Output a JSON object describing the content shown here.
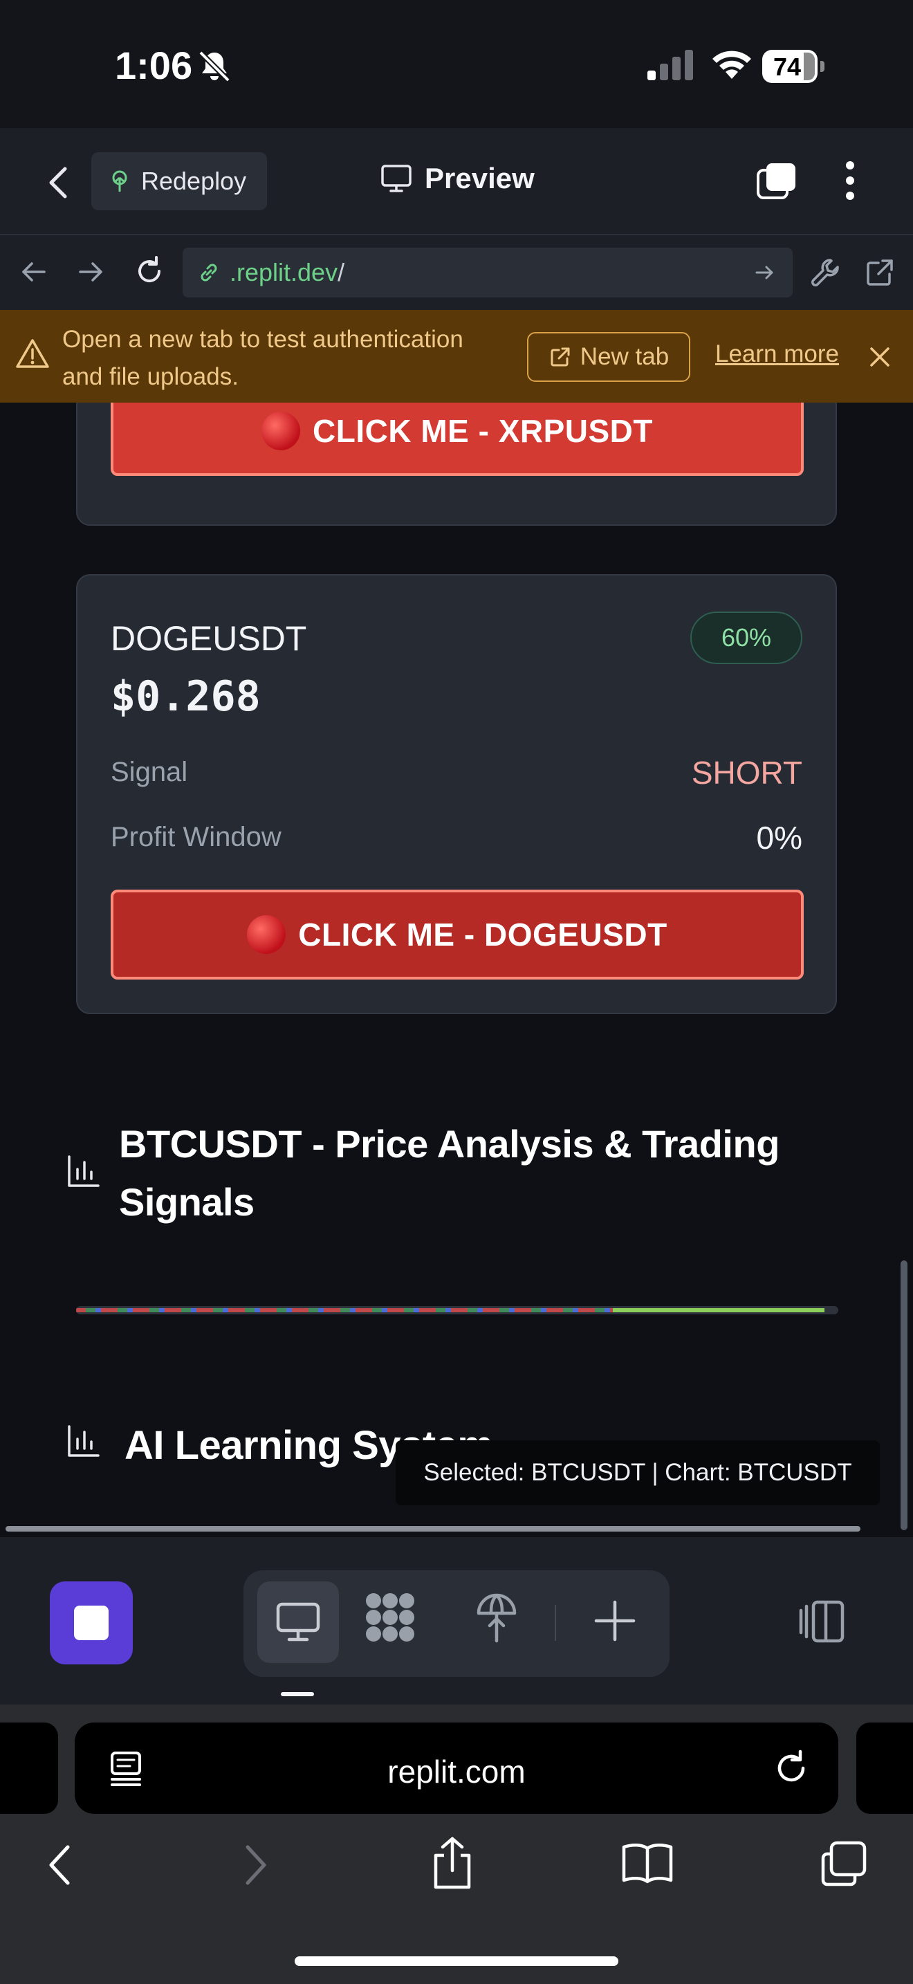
{
  "status_bar": {
    "time": "1:06",
    "battery": "74"
  },
  "header": {
    "redeploy_label": "Redeploy",
    "preview_label": "Preview"
  },
  "url_bar": {
    "domain": ".replit.dev",
    "path": "/"
  },
  "banner": {
    "message": "Open a new tab to test authentication and file uploads.",
    "new_tab_label": "New tab",
    "learn_more_label": "Learn more"
  },
  "cards": {
    "xrp": {
      "button_label": "CLICK ME - XRPUSDT"
    },
    "doge": {
      "symbol": "DOGEUSDT",
      "price": "$0.268",
      "confidence": "60%",
      "signal_label": "Signal",
      "signal_value": "SHORT",
      "profit_window_label": "Profit Window",
      "profit_window_value": "0%",
      "button_label": "CLICK ME - DOGEUSDT"
    }
  },
  "analysis": {
    "title": "BTCUSDT - Price Analysis & Trading Signals"
  },
  "ai_section": {
    "title": "AI Learning System"
  },
  "tooltip": {
    "text": "Selected: BTCUSDT | Chart: BTCUSDT"
  },
  "safari": {
    "address": "replit.com"
  },
  "colors": {
    "accent_purple": "#5a3cd6",
    "danger_red": "#d23a32",
    "short_color": "#f4a6a0",
    "confidence_green": "#8fe0a5",
    "url_green": "#6dd18a",
    "banner_bg": "#5a3808"
  }
}
